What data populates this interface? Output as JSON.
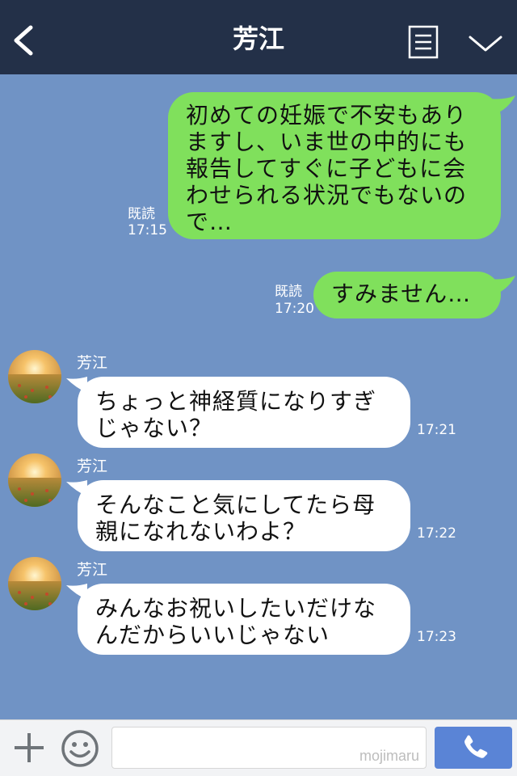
{
  "header": {
    "title": "芳江",
    "back_icon": "chevron-left-icon",
    "menu_icon": "note-icon",
    "more_icon": "chevron-down-icon"
  },
  "messages": [
    {
      "side": "out",
      "text_lines": [
        "初めての妊娠で不安もあり",
        "ますし、いま世の中的にも",
        "報告してすぐに子どもに会",
        "わせられる状況でもないの",
        "で…"
      ],
      "read": "既読",
      "time": "17:15"
    },
    {
      "side": "out",
      "text_lines": [
        "すみません…"
      ],
      "read": "既読",
      "time": "17:20"
    },
    {
      "side": "in",
      "sender": "芳江",
      "text_lines": [
        "ちょっと神経質になりすぎ",
        "じゃない？"
      ],
      "time": "17:21"
    },
    {
      "side": "in",
      "sender": "芳江",
      "text_lines": [
        "そんなこと気にしてたら母",
        "親になれないわよ？"
      ],
      "time": "17:22"
    },
    {
      "side": "in",
      "sender": "芳江",
      "text_lines": [
        "みんなお祝いしたいだけな",
        "んだからいいじゃない"
      ],
      "time": "17:23"
    }
  ],
  "footer": {
    "input_value": "",
    "watermark": "mojimaru"
  },
  "colors": {
    "background": "#7093c5",
    "header": "#233048",
    "outgoing_bubble": "#80e05c",
    "incoming_bubble": "#ffffff",
    "call_button": "#5a84d6"
  }
}
